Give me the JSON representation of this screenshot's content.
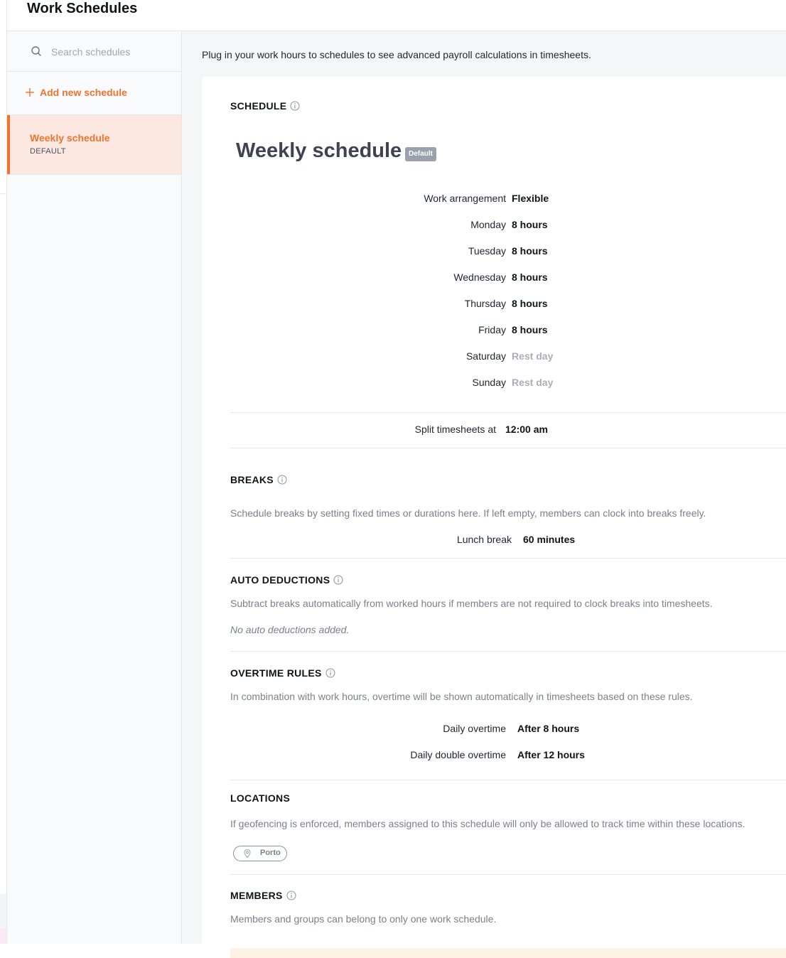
{
  "app": {
    "title": "Work Schedules"
  },
  "sidebar": {
    "search_placeholder": "Search schedules",
    "add_label": "Add new schedule",
    "items": [
      {
        "name": "Weekly schedule",
        "sub": "DEFAULT",
        "selected": true
      }
    ]
  },
  "main": {
    "intro": "Plug in your work hours to schedules to see advanced payroll calculations in timesheets.",
    "schedule": {
      "section_label": "SCHEDULE",
      "name": "Weekly schedule",
      "badge": "Default",
      "arrangement_label": "Work arrangement",
      "arrangement_value": "Flexible",
      "days": [
        {
          "label": "Monday",
          "value": "8 hours"
        },
        {
          "label": "Tuesday",
          "value": "8 hours"
        },
        {
          "label": "Wednesday",
          "value": "8 hours"
        },
        {
          "label": "Thursday",
          "value": "8 hours"
        },
        {
          "label": "Friday",
          "value": "8 hours"
        },
        {
          "label": "Saturday",
          "value": "Rest day"
        },
        {
          "label": "Sunday",
          "value": "Rest day"
        }
      ],
      "split_label": "Split timesheets at",
      "split_value": "12:00 am"
    },
    "breaks": {
      "title": "BREAKS",
      "desc": "Schedule breaks by setting fixed times or durations here. If left empty, members can clock into breaks freely.",
      "items": [
        {
          "label": "Lunch break",
          "value": "60 minutes"
        }
      ]
    },
    "auto_deductions": {
      "title": "AUTO DEDUCTIONS",
      "desc": "Subtract breaks automatically from worked hours if members are not required to clock breaks into timesheets.",
      "empty": "No auto deductions added."
    },
    "overtime": {
      "title": "OVERTIME RULES",
      "desc": "In combination with work hours, overtime will be shown automatically in timesheets based on these rules.",
      "rules": [
        {
          "label": "Daily overtime",
          "value": "After 8 hours"
        },
        {
          "label": "Daily double overtime",
          "value": "After 12 hours"
        }
      ]
    },
    "locations": {
      "title": "LOCATIONS",
      "desc": "If geofencing is enforced, members assigned to this schedule will only be allowed to track time within these locations.",
      "items": [
        "Porto"
      ]
    },
    "members": {
      "title": "MEMBERS",
      "desc": "Members and groups can belong to only one work schedule."
    }
  },
  "colors": {
    "accent": "#f0742f",
    "selected_bg": "#fde8e1",
    "muted": "#7a808c",
    "badge_bg": "#9aa0ac"
  }
}
